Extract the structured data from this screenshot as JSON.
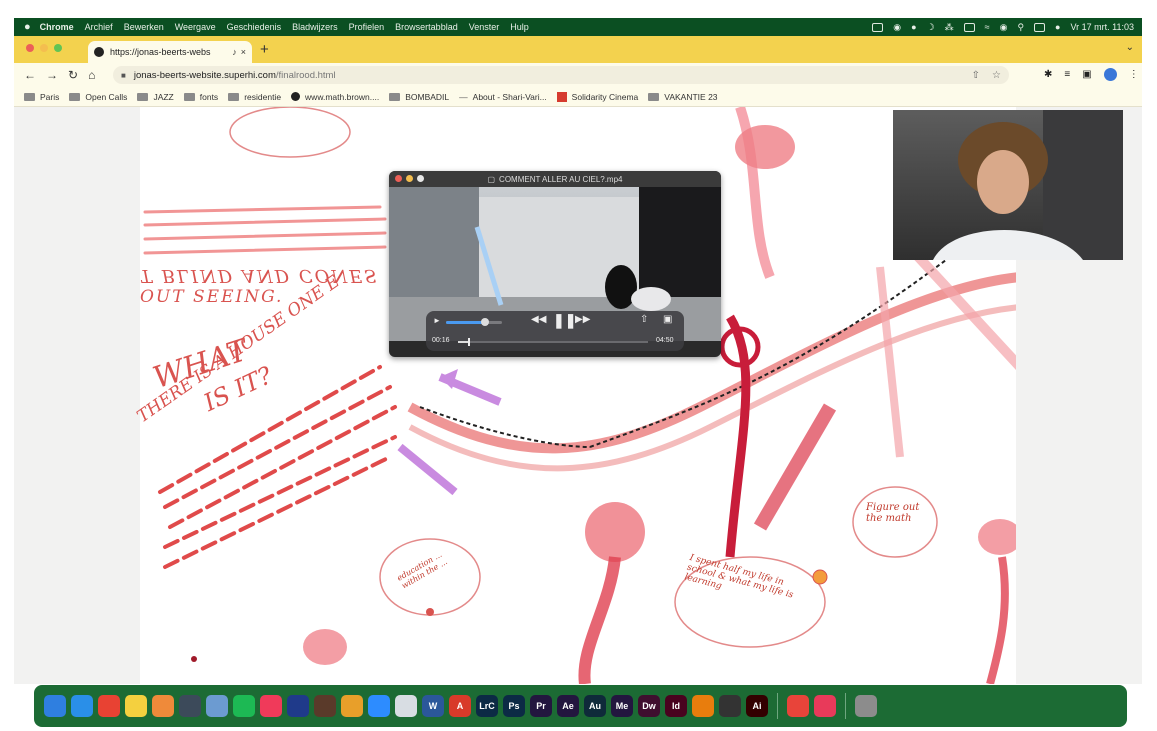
{
  "menubar": {
    "apple": "",
    "app": "Chrome",
    "items": [
      "Archief",
      "Bewerken",
      "Weergave",
      "Geschiedenis",
      "Bladwijzers",
      "Profielen",
      "Browsertabblad",
      "Venster",
      "Hulp"
    ],
    "clock": "Vr 17 mrt. 11:03"
  },
  "tab": {
    "title": "https://jonas-beerts-webs",
    "audio_icon": "speaker-icon",
    "close": "×",
    "new_tab": "+"
  },
  "address": {
    "host": "jonas-beerts-website.superhi.com",
    "path": "/finalrood.html"
  },
  "bookmarks": [
    {
      "label": "Paris",
      "icon": "folder-icon"
    },
    {
      "label": "Open Calls",
      "icon": "folder-icon"
    },
    {
      "label": "JAZZ",
      "icon": "folder-icon"
    },
    {
      "label": "fonts",
      "icon": "folder-icon"
    },
    {
      "label": "residentie",
      "icon": "folder-icon"
    },
    {
      "label": "www.math.brown....",
      "icon": "globe-icon"
    },
    {
      "label": "BOMBADIL",
      "icon": "folder-icon"
    },
    {
      "label": "About - Shari-Vari...",
      "icon": "dash-icon"
    },
    {
      "label": "Solidarity Cinema",
      "icon": "red-square-icon"
    },
    {
      "label": "VAKANTIE 23",
      "icon": "folder-icon"
    }
  ],
  "drawing": {
    "mirrored_text": "T BLIND AND CONES",
    "text_out": "OUT SEEING.",
    "what": "WHAT",
    "is_it": "IS IT?",
    "house": "THERE IS A HOUSE ONE E",
    "bubble_figure": "Figure out the math",
    "bubble_half": "I spent half my life in school & what my life is learning",
    "bubble_edu": "education ... within the ..."
  },
  "video": {
    "title": "COMMENT ALLER AU CIEL?.mp4",
    "time_elapsed": "00:16",
    "time_total": "04:50",
    "volume_level": 0.7,
    "progress": 0.055
  },
  "dock": {
    "apps": [
      {
        "name": "finder-icon",
        "label": "",
        "color": "#2f7fe0"
      },
      {
        "name": "safari-icon",
        "label": "",
        "color": "#2a8fe8"
      },
      {
        "name": "chrome-icon",
        "label": "",
        "color": "#e84233"
      },
      {
        "name": "notes-icon",
        "label": "",
        "color": "#f4d03f"
      },
      {
        "name": "photos-icon",
        "label": "",
        "color": "#ef8a3a"
      },
      {
        "name": "quicktime-icon",
        "label": "",
        "color": "#3c4a5a"
      },
      {
        "name": "preview-icon",
        "label": "",
        "color": "#6c9bd1"
      },
      {
        "name": "spotify-icon",
        "label": "",
        "color": "#1db954"
      },
      {
        "name": "music-icon",
        "label": "",
        "color": "#f03a5a"
      },
      {
        "name": "readdle-icon",
        "label": "",
        "color": "#1f3a8a"
      },
      {
        "name": "capo-icon",
        "label": "",
        "color": "#5a3a2a"
      },
      {
        "name": "garageband-icon",
        "label": "",
        "color": "#e89f2a"
      },
      {
        "name": "zoom-icon",
        "label": "",
        "color": "#2d8cff"
      },
      {
        "name": "blank-app-icon",
        "label": "",
        "color": "#d8dde3"
      },
      {
        "name": "word-icon",
        "label": "W",
        "color": "#2b579a"
      },
      {
        "name": "acrobat-icon",
        "label": "A",
        "color": "#d83a2a"
      },
      {
        "name": "lightroom-classic-icon",
        "label": "LrC",
        "color": "#0c2a45"
      },
      {
        "name": "photoshop-icon",
        "label": "Ps",
        "color": "#0c2a45"
      },
      {
        "name": "premiere-icon",
        "label": "Pr",
        "color": "#23163f"
      },
      {
        "name": "after-effects-icon",
        "label": "Ae",
        "color": "#23163f"
      },
      {
        "name": "audition-icon",
        "label": "Au",
        "color": "#0f2a3a"
      },
      {
        "name": "media-encoder-icon",
        "label": "Me",
        "color": "#23163f"
      },
      {
        "name": "dreamweaver-icon",
        "label": "Dw",
        "color": "#3f0f2f"
      },
      {
        "name": "indesign-icon",
        "label": "Id",
        "color": "#49021f"
      },
      {
        "name": "blender-icon",
        "label": "",
        "color": "#e87d0d"
      },
      {
        "name": "davinci-icon",
        "label": "",
        "color": "#333333"
      },
      {
        "name": "illustrator-icon",
        "label": "Ai",
        "color": "#330000"
      },
      {
        "name": "preview-red-icon",
        "label": "",
        "color": "#e8443a"
      },
      {
        "name": "creative-cloud-icon",
        "label": "",
        "color": "#e83a5a"
      },
      {
        "name": "trash-icon",
        "label": "",
        "color": "#8c8c8c"
      }
    ]
  }
}
